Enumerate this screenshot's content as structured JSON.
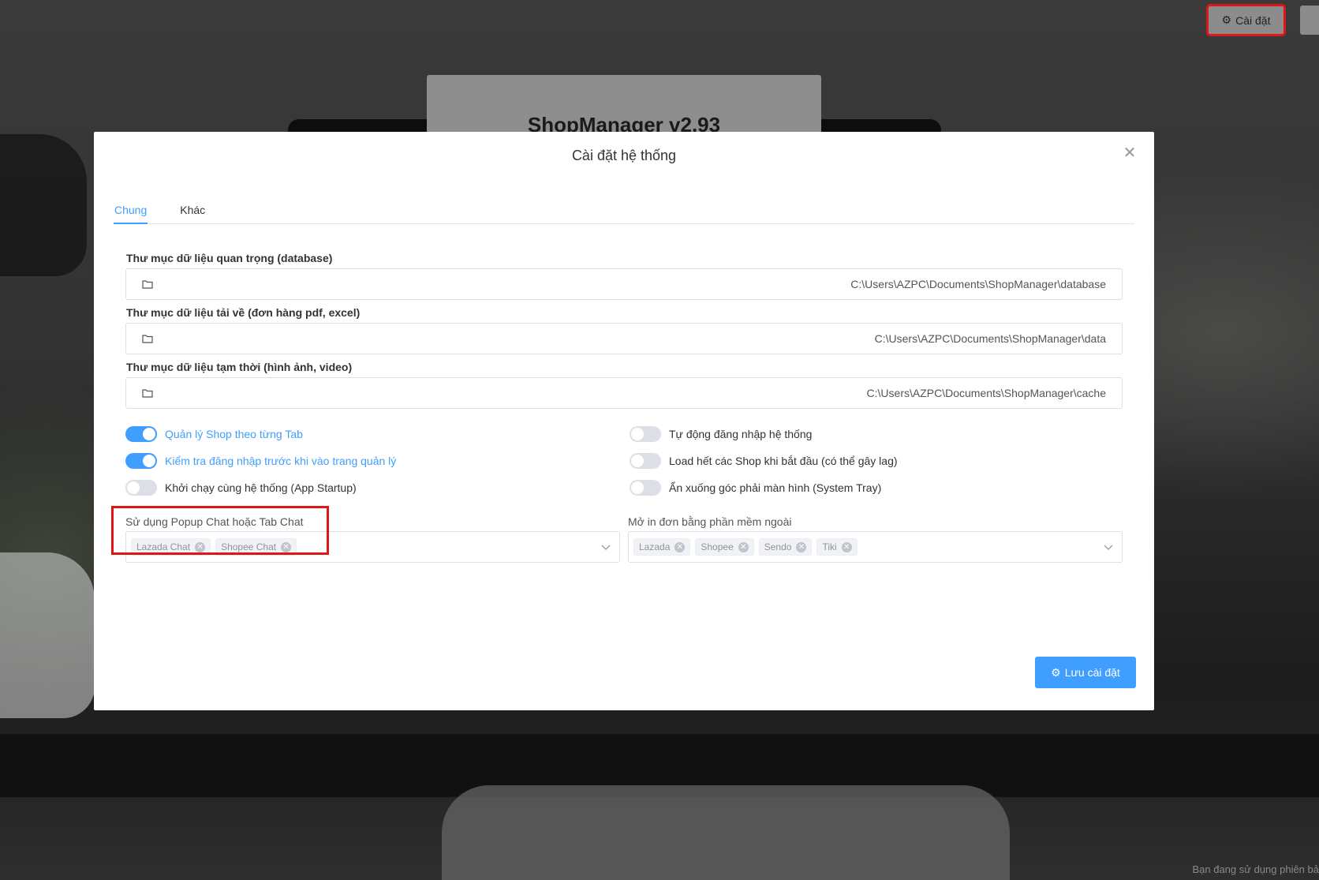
{
  "background": {
    "app_title": "ShopManager v2.93",
    "footer_text": "Bạn đang sử dụng phiên bả"
  },
  "topbar": {
    "settings_label": "Cài đặt"
  },
  "modal": {
    "title": "Cài đặt hệ thống",
    "tabs": [
      {
        "label": "Chung",
        "active": true
      },
      {
        "label": "Khác",
        "active": false
      }
    ],
    "paths": [
      {
        "label": "Thư mục dữ liệu quan trọng (database)",
        "value": "C:\\Users\\AZPC\\Documents\\ShopManager\\database"
      },
      {
        "label": "Thư mục dữ liệu tải về (đơn hàng pdf, excel)",
        "value": "C:\\Users\\AZPC\\Documents\\ShopManager\\data"
      },
      {
        "label": "Thư mục dữ liệu tạm thời (hình ảnh, video)",
        "value": "C:\\Users\\AZPC\\Documents\\ShopManager\\cache"
      }
    ],
    "toggles_left": [
      {
        "label": "Quản lý Shop theo từng Tab",
        "on": true
      },
      {
        "label": "Kiểm tra đăng nhập trước khi vào trang quản lý",
        "on": true
      },
      {
        "label": "Khởi chạy cùng hệ thống (App Startup)",
        "on": false
      }
    ],
    "toggles_right": [
      {
        "label": "Tự động đăng nhập hệ thống",
        "on": false
      },
      {
        "label": "Load hết các Shop khi bắt đầu (có thể gây lag)",
        "on": false
      },
      {
        "label": "Ẩn xuống góc phải màn hình (System Tray)",
        "on": false
      }
    ],
    "chat_select": {
      "label": "Sử dụng Popup Chat hoặc Tab Chat",
      "tags": [
        "Lazada Chat",
        "Shopee Chat"
      ]
    },
    "print_select": {
      "label": "Mở in đơn bằng phần mềm ngoài",
      "tags": [
        "Lazada",
        "Shopee",
        "Sendo",
        "Tiki"
      ]
    },
    "save_label": "Lưu cài đặt"
  },
  "colors": {
    "accent": "#409eff",
    "highlight": "#e01515"
  }
}
